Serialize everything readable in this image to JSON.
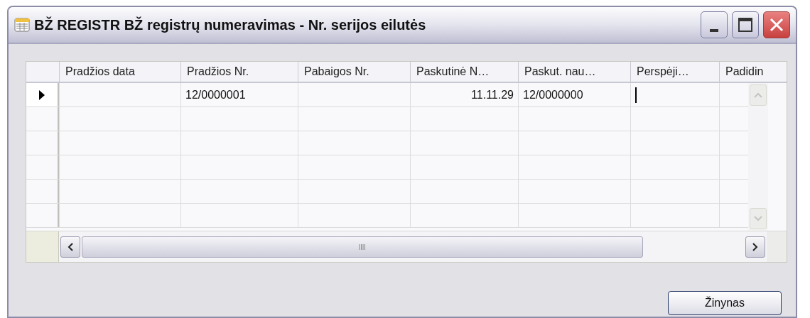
{
  "window": {
    "title": "BŽ REGISTR BŽ registrų numeravimas - Nr. serijos eilutės"
  },
  "table": {
    "columns": [
      {
        "label": "Pradžios data",
        "kind": "text"
      },
      {
        "label": "Pradžios Nr.",
        "kind": "text"
      },
      {
        "label": "Pabaigos Nr.",
        "kind": "text"
      },
      {
        "label": "Paskutinė N…",
        "kind": "date"
      },
      {
        "label": "Paskut. nau…",
        "kind": "text"
      },
      {
        "label": "Perspėji…",
        "kind": "text"
      },
      {
        "label": "Padidin",
        "kind": "text"
      }
    ],
    "rows": [
      {
        "selected": true,
        "cells": [
          {
            "focused": false
          },
          {
            "text": "12/0000001",
            "focused": false
          },
          {
            "focused": false
          },
          {
            "text": "11.11.29",
            "focused": false
          },
          {
            "text": "12/0000000",
            "focused": false
          },
          {
            "focused": true
          },
          {
            "focused": false
          }
        ]
      }
    ]
  },
  "buttons": [
    {
      "label": "Žinynas"
    }
  ]
}
